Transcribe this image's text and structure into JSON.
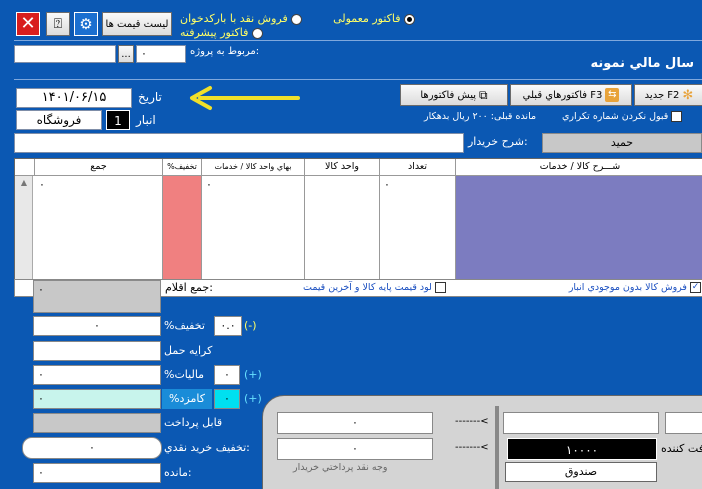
{
  "toolbar": {
    "price_list": "ليست قيمت ها",
    "radio_normal": "فاکتور معمولی",
    "radio_barcode": "فروش نقد با بارکدخوان",
    "radio_advanced": "فاکتور پیشرفته"
  },
  "project": {
    "label": "مربوط به پروژه:",
    "value": "۰",
    "browse": "..."
  },
  "company": "سال مالي نمونه",
  "nav": {
    "new": "جديد F2",
    "prev": "فاکتورهاي قبلي F3",
    "preview": "پيش فاکتورها"
  },
  "options": {
    "no_duplicate": "قبول نکردن شماره تکراري",
    "prev_balance": "مانده قبلی: ۲۰۰ ریال بدهکار"
  },
  "header": {
    "date_label": "تاريخ",
    "date_value": "۱۴۰۱/۰۶/۱۵",
    "warehouse_label": "انبار",
    "warehouse_code": "1",
    "warehouse_name": "فروشگاه"
  },
  "buyer": {
    "name": "حميد",
    "desc_label": "شرح خريدار:",
    "desc_value": ""
  },
  "grid": {
    "columns": [
      "شـــرح کالا / خدمات",
      "تعداد",
      "واحد کالا",
      "بهاي واحد کالا / خدمات",
      "%تخفيف",
      "جمع"
    ],
    "row1": {
      "qty": "۰",
      "price": "۰",
      "total": "۰"
    }
  },
  "footer_opts": {
    "total_items_label": "جمع اقلام:",
    "load_price": "لود قيمت پايه کالا و آخرين قيمت",
    "sell_no_stock": "فروش کالا بدون موجودي انبار"
  },
  "totals": {
    "discount_label": "%تخفيف",
    "discount_pct": "۰.۰",
    "discount_value": "۰",
    "minus": "(-)",
    "shipping_label": "کرايه حمل",
    "tax_label": "%ماليات",
    "tax_pct": "۰",
    "tax_value": "۰",
    "plus": "(+)",
    "commission_label": "%کامزد",
    "commission_pct": "۰",
    "commission_value": "۰",
    "payable_label": "قابل پرداخت",
    "cash_discount_label": "تخفيف خريد نقدي:",
    "cash_discount_value": "۰",
    "remaining_label": "مانده:",
    "remaining_value": "۰"
  },
  "payment": {
    "field1": "۰",
    "field2": "۰",
    "arrow1": "-------<",
    "arrow2": "-------<",
    "receiver_label": "دريافت کننده:",
    "amount": "۱۰۰۰۰",
    "cash_label": "وجه نقد پرداختي خريدار",
    "cashbox": "صندوق"
  },
  "colors": {
    "bg": "#0b58b3",
    "desc_col": "#7c7cc0",
    "discount_col": "#f08080",
    "commission": "#c8f4ec",
    "accent": "#ffff66"
  }
}
